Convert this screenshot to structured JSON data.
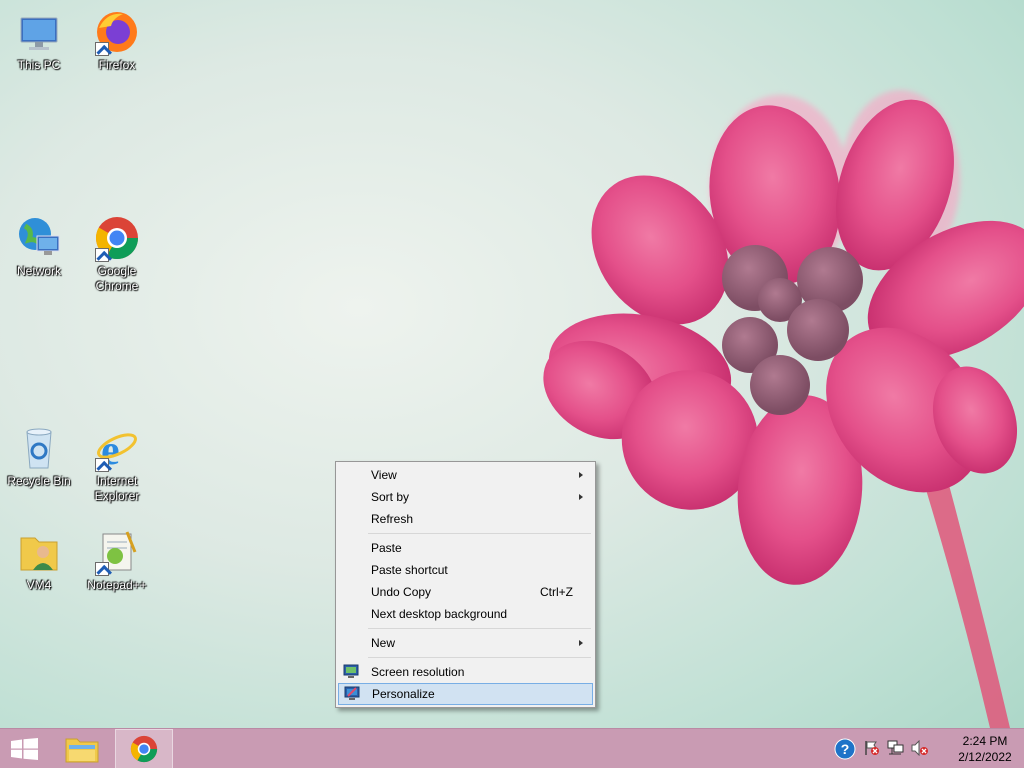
{
  "desktop": {
    "icons": [
      {
        "label": "This PC",
        "icon": "this-pc-icon"
      },
      {
        "label": "Firefox",
        "icon": "firefox-icon"
      },
      {
        "label": "Network",
        "icon": "network-icon"
      },
      {
        "label": "Google Chrome",
        "icon": "chrome-icon"
      },
      {
        "label": "Recycle Bin",
        "icon": "recycle-bin-icon"
      },
      {
        "label": "Internet Explorer",
        "icon": "internet-explorer-icon"
      },
      {
        "label": "VM4",
        "icon": "user-folder-icon"
      },
      {
        "label": "Notepad++",
        "icon": "notepad-plus-plus-icon"
      }
    ]
  },
  "context_menu": {
    "items": [
      {
        "label": "View",
        "submenu": true
      },
      {
        "label": "Sort by",
        "submenu": true
      },
      {
        "label": "Refresh"
      },
      {
        "label": "Paste"
      },
      {
        "label": "Paste shortcut"
      },
      {
        "label": "Undo Copy",
        "shortcut": "Ctrl+Z"
      },
      {
        "label": "Next desktop background"
      },
      {
        "label": "New",
        "submenu": true
      },
      {
        "label": "Screen resolution",
        "icon": "screen-resolution-icon"
      },
      {
        "label": "Personalize",
        "icon": "personalize-icon",
        "highlighted": true
      }
    ]
  },
  "taskbar": {
    "start_icon": "windows-logo-icon",
    "pinned": [
      "file-explorer-icon",
      "chrome-icon"
    ],
    "tray_icons": [
      "help-icon",
      "action-center-flag-icon",
      "network-tray-icon",
      "volume-muted-icon"
    ],
    "clock": {
      "time": "2:24 PM",
      "date": "2/12/2022"
    }
  },
  "colors": {
    "taskbar": "#c99bb3",
    "menu_bg": "#f1f1f1",
    "menu_highlight": "#d1e2f2",
    "menu_highlight_border": "#78aee5",
    "flower": "#e0457f"
  }
}
